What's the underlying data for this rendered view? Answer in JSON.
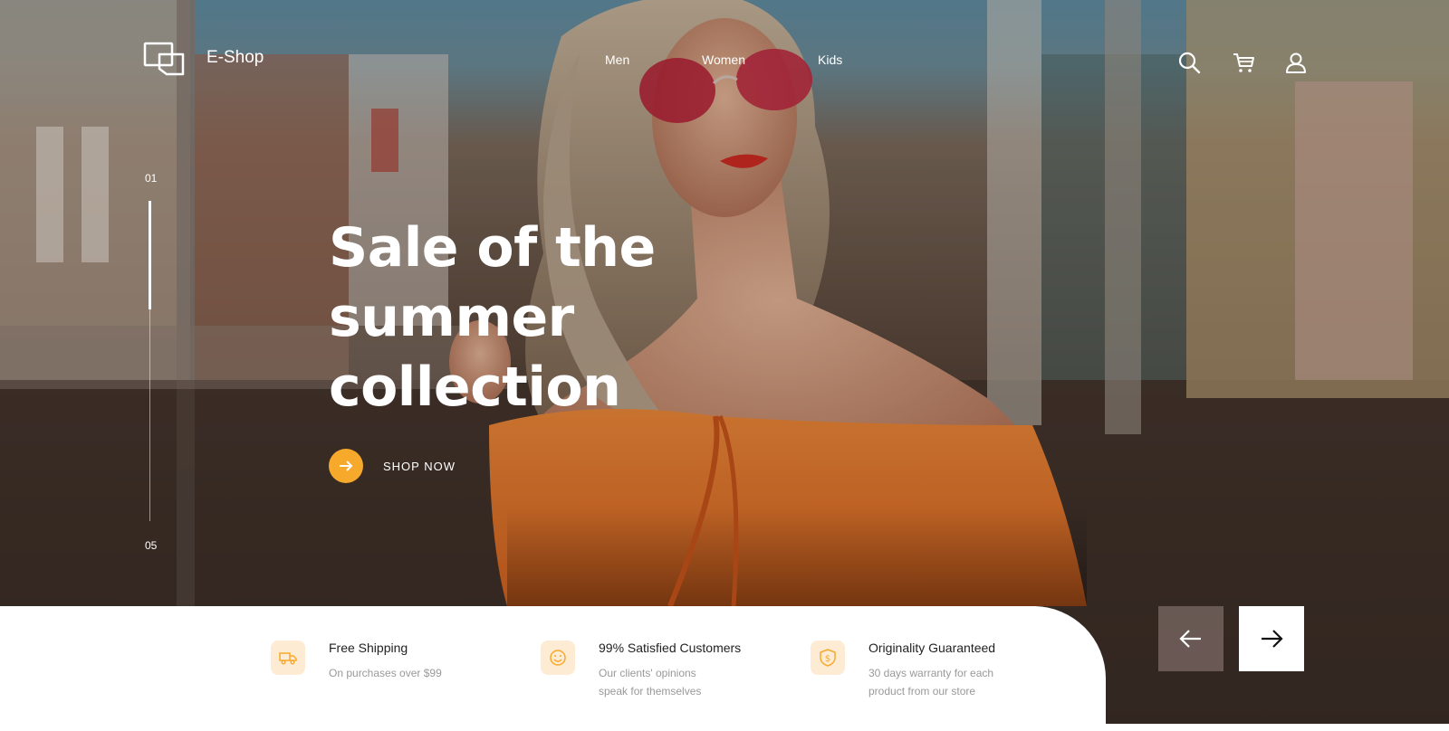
{
  "brand": {
    "name": "E-Shop",
    "logo_icon": "chat-bubbles-icon"
  },
  "nav": {
    "items": [
      "Men",
      "Women",
      "Kids"
    ]
  },
  "header_icons": [
    "search-icon",
    "cart-icon",
    "user-icon"
  ],
  "slider": {
    "current": "01",
    "total": "05",
    "progress_fraction": 0.34
  },
  "hero": {
    "headline_lines": [
      "Sale of the",
      "summer",
      "collection"
    ],
    "cta_label": "SHOP NOW",
    "cta_icon": "arrow-right-icon"
  },
  "features": [
    {
      "icon": "truck-icon",
      "title": "Free Shipping",
      "desc_lines": [
        "On purchases over $99"
      ]
    },
    {
      "icon": "smile-icon",
      "title": "99% Satisfied Customers",
      "desc_lines": [
        "Our clients' opinions",
        "speak for themselves"
      ]
    },
    {
      "icon": "shield-dollar-icon",
      "title": "Originality Guaranteed",
      "desc_lines": [
        "30 days warranty for each",
        "product from our store"
      ]
    }
  ],
  "carousel_controls": {
    "prev_icon": "arrow-left-icon",
    "next_icon": "arrow-right-icon"
  },
  "colors": {
    "accent": "#f7a92c",
    "accent_soft": "#fdebd4",
    "text_dark": "#222222",
    "text_muted": "#999999"
  }
}
